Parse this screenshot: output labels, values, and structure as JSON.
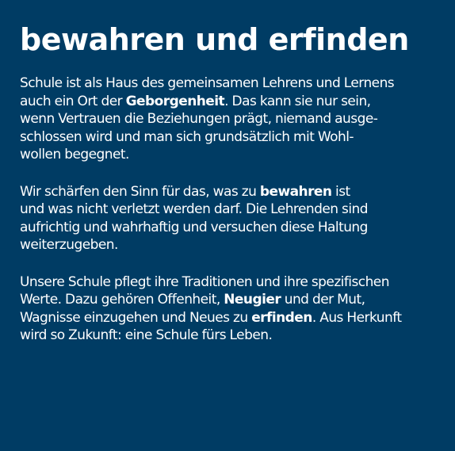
{
  "title": "bewahren und erfinden",
  "paragraphs": [
    {
      "lines": [
        {
          "segments": [
            {
              "text": "Schule ist als Haus des gemeinsamen Lehrens und Lernens",
              "bold": false
            }
          ]
        },
        {
          "segments": [
            {
              "text": "auch ein Ort der ",
              "bold": false
            },
            {
              "text": "Geborgenheit",
              "bold": true
            },
            {
              "text": ". Das kann sie nur sein,",
              "bold": false
            }
          ]
        },
        {
          "segments": [
            {
              "text": "wenn Vertrauen die Beziehungen prägt, niemand ausge-",
              "bold": false
            }
          ]
        },
        {
          "segments": [
            {
              "text": "schlossen wird und man sich grundsätzlich mit Wohl-",
              "bold": false
            }
          ]
        },
        {
          "segments": [
            {
              "text": "wollen begegnet.",
              "bold": false
            }
          ]
        }
      ]
    },
    {
      "lines": [
        {
          "segments": [
            {
              "text": "Wir schärfen den Sinn für das, was zu ",
              "bold": false
            },
            {
              "text": "bewahren",
              "bold": true
            },
            {
              "text": " ist",
              "bold": false
            }
          ]
        },
        {
          "segments": [
            {
              "text": "und was nicht verletzt werden darf. Die Lehrenden sind",
              "bold": false
            }
          ]
        },
        {
          "segments": [
            {
              "text": "aufrichtig und wahrhaftig und versuchen diese Haltung",
              "bold": false
            }
          ]
        },
        {
          "segments": [
            {
              "text": "weiterzugeben.",
              "bold": false
            }
          ]
        }
      ]
    },
    {
      "lines": [
        {
          "segments": [
            {
              "text": "Unsere Schule pflegt ihre Traditionen und ihre spezifischen",
              "bold": false
            }
          ]
        },
        {
          "segments": [
            {
              "text": "Werte. Dazu gehören Offenheit, ",
              "bold": false
            },
            {
              "text": "Neugier",
              "bold": true
            },
            {
              "text": " und der Mut,",
              "bold": false
            }
          ]
        },
        {
          "segments": [
            {
              "text": "Wagnisse einzugehen und Neues zu ",
              "bold": false
            },
            {
              "text": "erfinden",
              "bold": true
            },
            {
              "text": ". Aus Herkunft",
              "bold": false
            }
          ]
        },
        {
          "segments": [
            {
              "text": "wird so Zukunft: eine Schule fürs Leben.",
              "bold": false
            }
          ]
        }
      ]
    }
  ],
  "colors": {
    "background": "#003c64",
    "text": "#ffffff"
  }
}
